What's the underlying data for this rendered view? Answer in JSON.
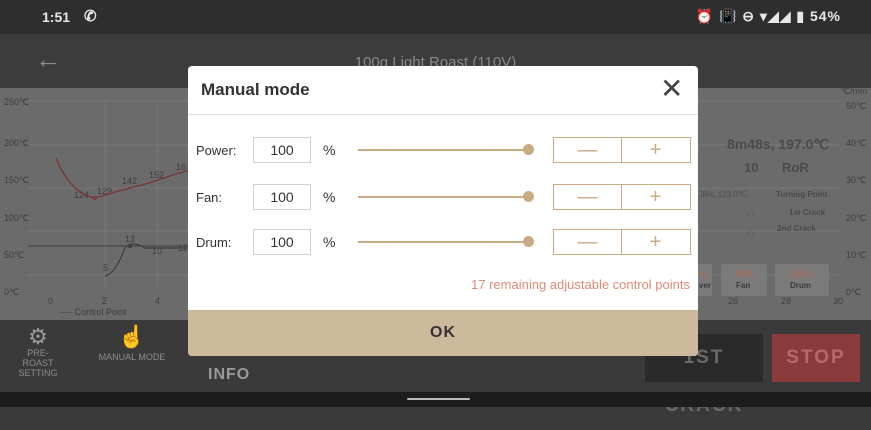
{
  "status": {
    "time": "1:51",
    "call_icon": "phone-icon",
    "right_indicators": "⏰ 📳 ⊖ ▾◢◢ ▮",
    "battery": "54%"
  },
  "appbar": {
    "back_icon": "arrow-left-icon",
    "title": "100g Light Roast (110V)"
  },
  "chart": {
    "y_left_ticks": [
      "250℃",
      "200℃",
      "150℃",
      "100℃",
      "50℃",
      "0℃"
    ],
    "y_right_unit": "℃/min",
    "y_right_ticks": [
      "50℃",
      "40℃",
      "30℃",
      "20℃",
      "10℃",
      "0℃"
    ],
    "x_ticks": [
      "0",
      "2",
      "4",
      "26",
      "28",
      "30"
    ],
    "legend": "---- Control Point",
    "temp_labels": [
      "124",
      "129",
      "142",
      "152",
      "16"
    ],
    "fan_labels": [
      "5",
      "13",
      "10",
      "11"
    ],
    "summary": "8m48s, 197.0℃",
    "ror_value": "10",
    "ror_label": "RoR",
    "turning_point_value": "38s, 123.0℃",
    "turning_point_label": "Turning Point",
    "first_crack_value": "-:-",
    "first_crack_label": "1st Crack",
    "second_crack_value": "-:-",
    "second_crack_label": "2nd Crack",
    "stats": [
      {
        "pct": "%",
        "name": "ver"
      },
      {
        "pct": "35%",
        "name": "Fan"
      },
      {
        "pct": "100%",
        "name": "Drum"
      }
    ]
  },
  "bottom": {
    "preroast_label": "PRE-ROAST SETTING",
    "manual_label": "MANUAL MODE",
    "info_label": "INFO",
    "crack_label": "1ST CRACK",
    "stop_label": "STOP"
  },
  "dialog": {
    "title": "Manual mode",
    "close_icon": "close-icon",
    "rows": [
      {
        "label": "Power:",
        "value": "100",
        "unit": "%",
        "level": 100
      },
      {
        "label": "Fan:",
        "value": "100",
        "unit": "%",
        "level": 100
      },
      {
        "label": "Drum:",
        "value": "100",
        "unit": "%",
        "level": 100
      }
    ],
    "minus": "—",
    "plus": "+",
    "remaining_text": "17 remaining adjustable control points",
    "ok_label": "OK"
  },
  "colors": {
    "accent": "#c9ab83",
    "warning": "#e08a76",
    "stop": "#8a3a3a"
  }
}
